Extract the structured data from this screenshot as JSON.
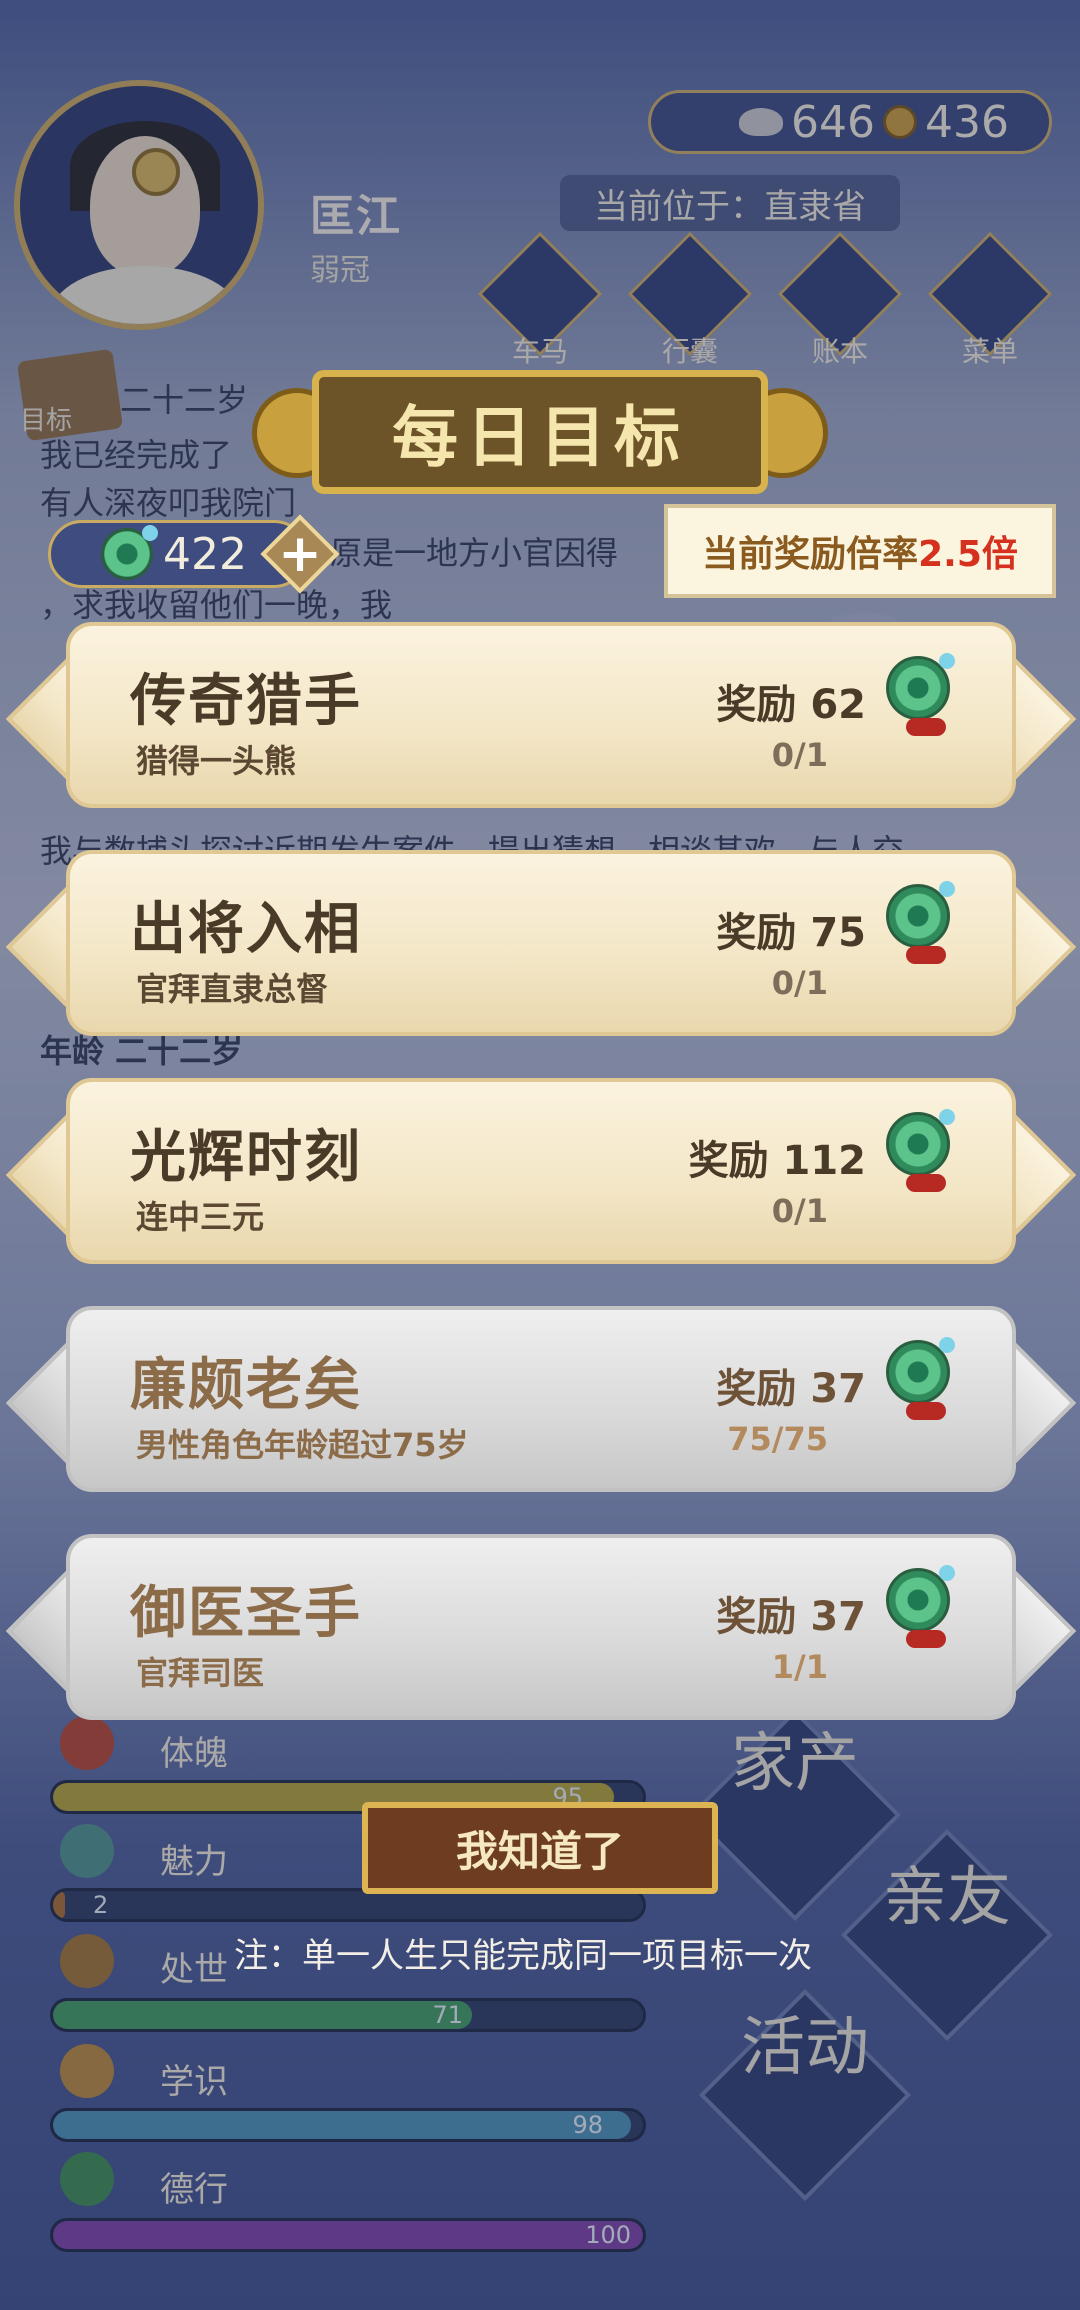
{
  "profile": {
    "name": "匡江",
    "age_title": "弱冠",
    "silver": "646",
    "copper": "436",
    "location": "当前位于：直隶省",
    "goal_tag": "目标"
  },
  "nav": [
    {
      "label": "车马"
    },
    {
      "label": "行囊"
    },
    {
      "label": "账本"
    },
    {
      "label": "菜单"
    }
  ],
  "background_story": [
    "二十二岁",
    "我已经完成了",
    "有人深夜叩我院门",
    "原是一地方小官因得",
    "，求我收留他们一晚，我",
    "我与数捕头探讨近期发生案件，提出猜想，相谈甚欢，与人交",
    "年龄 二十二岁"
  ],
  "stats": [
    {
      "label": "体魄",
      "value": "95",
      "fraction": 0.95,
      "color": "#b3a033"
    },
    {
      "label": "魅力",
      "value": "2",
      "fraction": 0.02,
      "color": "#a86a2c"
    },
    {
      "label": "处世",
      "value": "71",
      "fraction": 0.71,
      "color": "#3f9a5f"
    },
    {
      "label": "学识",
      "value": "98",
      "fraction": 0.98,
      "color": "#4a8fb1"
    },
    {
      "label": "德行",
      "value": "100",
      "fraction": 1.0,
      "color": "#7b3fa3"
    }
  ],
  "side_menu": [
    "家产",
    "亲友",
    "活动"
  ],
  "modal": {
    "title": "每日目标",
    "jade_balance": "422",
    "plus_label": "+",
    "multiplier_label": "当前奖励倍率",
    "multiplier_value": "2.5倍",
    "goals": [
      {
        "title": "传奇猎手",
        "desc": "猎得一头熊",
        "reward": "奖励 62",
        "progress": "0/1",
        "done": false
      },
      {
        "title": "出将入相",
        "desc": "官拜直隶总督",
        "reward": "奖励 75",
        "progress": "0/1",
        "done": false
      },
      {
        "title": "光辉时刻",
        "desc": "连中三元",
        "reward": "奖励 112",
        "progress": "0/1",
        "done": false
      },
      {
        "title": "廉颇老矣",
        "desc": "男性角色年龄超过75岁",
        "reward": "奖励 37",
        "progress": "75/75",
        "done": true
      },
      {
        "title": "御医圣手",
        "desc": "官拜司医",
        "reward": "奖励 37",
        "progress": "1/1",
        "done": true
      }
    ],
    "ack_button": "我知道了",
    "note": "注：单一人生只能完成同一项目标一次"
  },
  "colors": {
    "accent_gold": "#d8b24d",
    "multiplier_red": "#d6301e",
    "card_active": "#f3e6c6",
    "card_done": "#d9d9d9"
  }
}
